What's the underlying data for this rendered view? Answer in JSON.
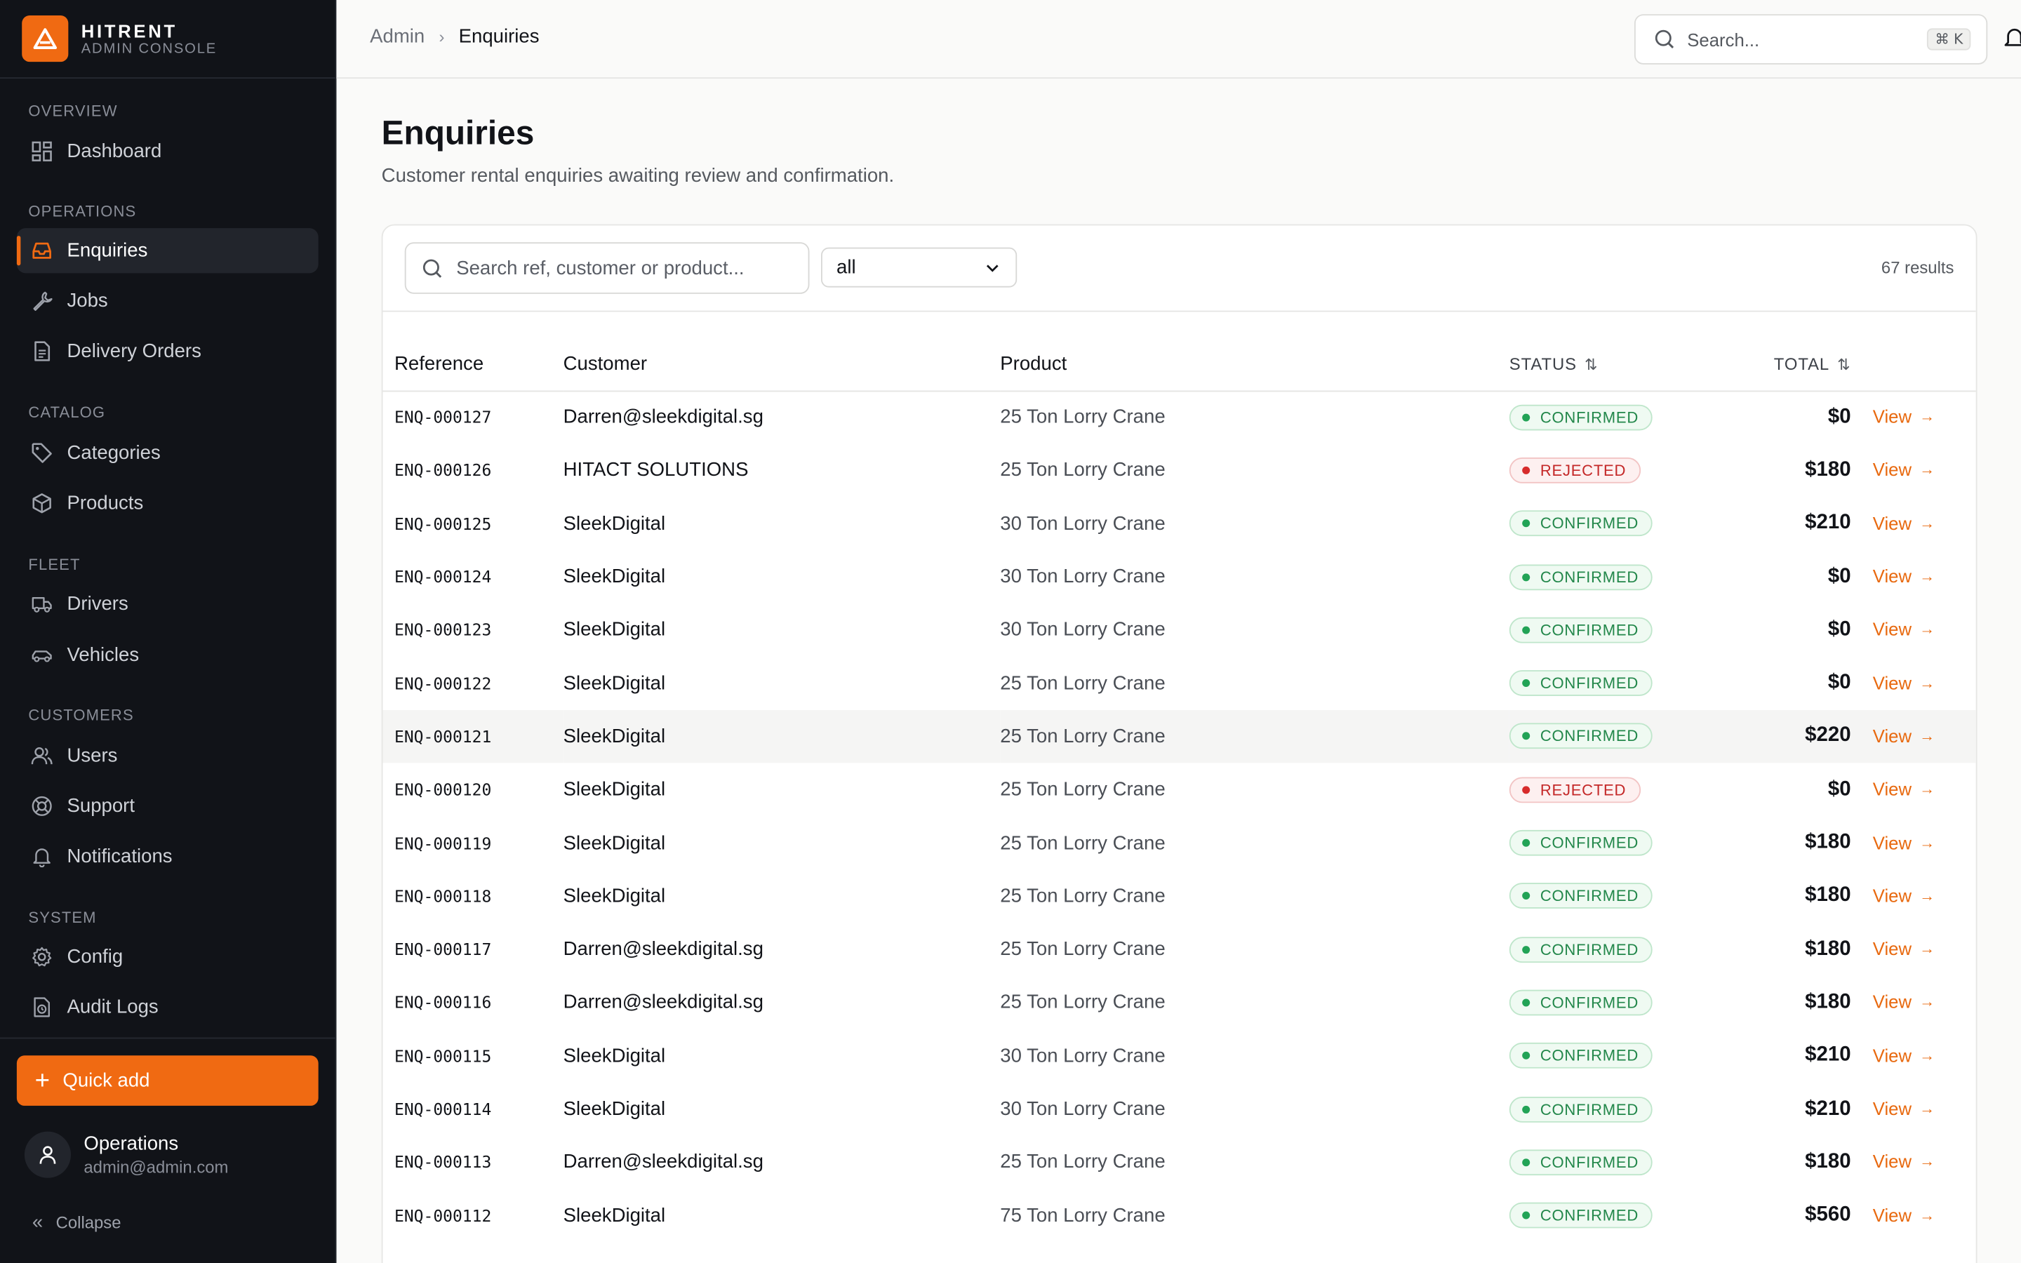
{
  "brand": {
    "name": "HITRENT",
    "subtitle": "ADMIN CONSOLE"
  },
  "sidebar": {
    "sections": [
      {
        "label": "OVERVIEW"
      },
      {
        "label": "OPERATIONS"
      },
      {
        "label": "CATALOG"
      },
      {
        "label": "FLEET"
      },
      {
        "label": "CUSTOMERS"
      },
      {
        "label": "SYSTEM"
      }
    ],
    "items": [
      {
        "label": "Dashboard",
        "icon": "dashboard-icon"
      },
      {
        "label": "Enquiries",
        "icon": "inbox-icon",
        "active": true
      },
      {
        "label": "Jobs",
        "icon": "wrench-icon"
      },
      {
        "label": "Delivery Orders",
        "icon": "document-icon"
      },
      {
        "label": "Categories",
        "icon": "tag-icon"
      },
      {
        "label": "Products",
        "icon": "box-icon"
      },
      {
        "label": "Drivers",
        "icon": "truck-icon"
      },
      {
        "label": "Vehicles",
        "icon": "car-icon"
      },
      {
        "label": "Users",
        "icon": "users-icon"
      },
      {
        "label": "Support",
        "icon": "lifebuoy-icon"
      },
      {
        "label": "Notifications",
        "icon": "bell-icon"
      },
      {
        "label": "Config",
        "icon": "gear-icon"
      },
      {
        "label": "Audit Logs",
        "icon": "audit-icon"
      }
    ],
    "quick_add": "Quick add",
    "user": {
      "name": "Operations",
      "email": "admin@admin.com"
    },
    "collapse": "Collapse"
  },
  "topbar": {
    "breadcrumb": [
      "Admin",
      "Enquiries"
    ],
    "search_placeholder": "Search...",
    "shortcut": "⌘ K"
  },
  "main": {
    "title": "Enquiries",
    "subtitle": "Customer rental enquiries awaiting review and confirmation.",
    "filter": {
      "search_placeholder": "Search ref, customer or product...",
      "status_value": "all",
      "result_count": "67 results"
    },
    "columns": [
      "Reference",
      "Customer",
      "Product",
      "STATUS",
      "TOTAL"
    ],
    "rows": [
      {
        "ref": "ENQ-000127",
        "customer": "Darren@sleekdigital.sg",
        "product": "25 Ton Lorry Crane",
        "status": "CONFIRMED",
        "total": "$0",
        "action": "View"
      },
      {
        "ref": "ENQ-000126",
        "customer": "HITACT SOLUTIONS",
        "product": "25 Ton Lorry Crane",
        "status": "REJECTED",
        "total": "$180",
        "action": "View"
      },
      {
        "ref": "ENQ-000125",
        "customer": "SleekDigital",
        "product": "30 Ton Lorry Crane",
        "status": "CONFIRMED",
        "total": "$210",
        "action": "View"
      },
      {
        "ref": "ENQ-000124",
        "customer": "SleekDigital",
        "product": "30 Ton Lorry Crane",
        "status": "CONFIRMED",
        "total": "$0",
        "action": "View"
      },
      {
        "ref": "ENQ-000123",
        "customer": "SleekDigital",
        "product": "30 Ton Lorry Crane",
        "status": "CONFIRMED",
        "total": "$0",
        "action": "View"
      },
      {
        "ref": "ENQ-000122",
        "customer": "SleekDigital",
        "product": "25 Ton Lorry Crane",
        "status": "CONFIRMED",
        "total": "$0",
        "action": "View"
      },
      {
        "ref": "ENQ-000121",
        "customer": "SleekDigital",
        "product": "25 Ton Lorry Crane",
        "status": "CONFIRMED",
        "total": "$220",
        "action": "View",
        "highlight": true
      },
      {
        "ref": "ENQ-000120",
        "customer": "SleekDigital",
        "product": "25 Ton Lorry Crane",
        "status": "REJECTED",
        "total": "$0",
        "action": "View"
      },
      {
        "ref": "ENQ-000119",
        "customer": "SleekDigital",
        "product": "25 Ton Lorry Crane",
        "status": "CONFIRMED",
        "total": "$180",
        "action": "View"
      },
      {
        "ref": "ENQ-000118",
        "customer": "SleekDigital",
        "product": "25 Ton Lorry Crane",
        "status": "CONFIRMED",
        "total": "$180",
        "action": "View"
      },
      {
        "ref": "ENQ-000117",
        "customer": "Darren@sleekdigital.sg",
        "product": "25 Ton Lorry Crane",
        "status": "CONFIRMED",
        "total": "$180",
        "action": "View"
      },
      {
        "ref": "ENQ-000116",
        "customer": "Darren@sleekdigital.sg",
        "product": "25 Ton Lorry Crane",
        "status": "CONFIRMED",
        "total": "$180",
        "action": "View"
      },
      {
        "ref": "ENQ-000115",
        "customer": "SleekDigital",
        "product": "30 Ton Lorry Crane",
        "status": "CONFIRMED",
        "total": "$210",
        "action": "View"
      },
      {
        "ref": "ENQ-000114",
        "customer": "SleekDigital",
        "product": "30 Ton Lorry Crane",
        "status": "CONFIRMED",
        "total": "$210",
        "action": "View"
      },
      {
        "ref": "ENQ-000113",
        "customer": "Darren@sleekdigital.sg",
        "product": "25 Ton Lorry Crane",
        "status": "CONFIRMED",
        "total": "$180",
        "action": "View"
      },
      {
        "ref": "ENQ-000112",
        "customer": "SleekDigital",
        "product": "75 Ton Lorry Crane",
        "status": "CONFIRMED",
        "total": "$560",
        "action": "View"
      }
    ]
  },
  "colors": {
    "accent": "#f06a12",
    "sidebar_bg": "#111318",
    "confirmed": "#22874a",
    "rejected": "#c42828"
  }
}
